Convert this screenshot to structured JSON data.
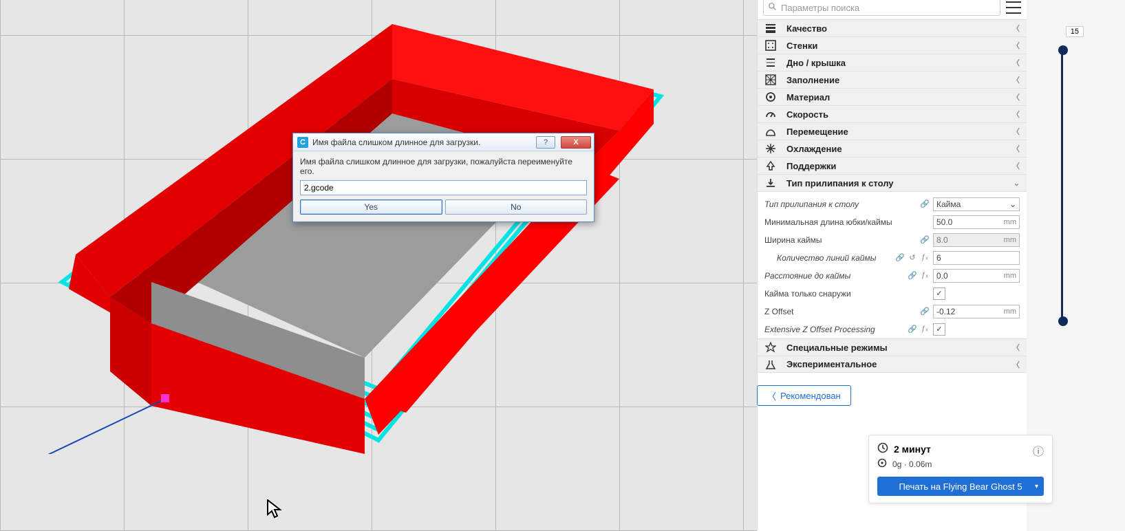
{
  "search": {
    "placeholder": "Параметры поиска"
  },
  "categories": [
    {
      "key": "quality",
      "label": "Качество",
      "expanded": false
    },
    {
      "key": "walls",
      "label": "Стенки",
      "expanded": false
    },
    {
      "key": "topbottom",
      "label": "Дно / крышка",
      "expanded": false
    },
    {
      "key": "infill",
      "label": "Заполнение",
      "expanded": false
    },
    {
      "key": "material",
      "label": "Материал",
      "expanded": false
    },
    {
      "key": "speed",
      "label": "Скорость",
      "expanded": false
    },
    {
      "key": "travel",
      "label": "Перемещение",
      "expanded": false
    },
    {
      "key": "cooling",
      "label": "Охлаждение",
      "expanded": false
    },
    {
      "key": "support",
      "label": "Поддержки",
      "expanded": false
    },
    {
      "key": "adhesion",
      "label": "Тип прилипания к столу",
      "expanded": true
    },
    {
      "key": "special",
      "label": "Специальные режимы",
      "expanded": false
    },
    {
      "key": "experimental",
      "label": "Экспериментальное",
      "expanded": false
    }
  ],
  "adhesion": {
    "type_label": "Тип прилипания к столу",
    "type_value": "Кайма",
    "min_len_label": "Минимальная длина юбки/каймы",
    "min_len_value": "50.0",
    "width_label": "Ширина каймы",
    "width_value": "8.0",
    "line_count_label": "Количество линий каймы",
    "line_count_value": "6",
    "distance_label": "Расстояние до каймы",
    "distance_value": "0.0",
    "outside_label": "Кайма только снаружи",
    "outside_checked": true,
    "zoff_label": "Z Offset",
    "zoff_value": "-0.12",
    "ezop_label": "Extensive Z Offset Processing",
    "ezop_checked": true,
    "unit_mm": "mm"
  },
  "recommend": {
    "label": "Рекомендован"
  },
  "action": {
    "time": "2 минут",
    "usage": "0g · 0.06m",
    "print_label": "Печать на Flying Bear Ghost 5"
  },
  "ruler": {
    "top_value": "15"
  },
  "dialog": {
    "title": "Имя файла слишком длинное для загрузки.",
    "message": "Имя файла слишком длинное для загрузки, пожалуйста переименуйте его.",
    "input_value": "2.gcode",
    "yes": "Yes",
    "no": "No",
    "help": "?",
    "close": "X"
  }
}
